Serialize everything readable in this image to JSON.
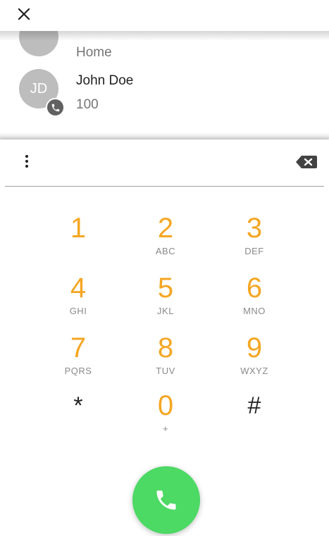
{
  "contacts": [
    {
      "name": "",
      "sub": "Home"
    },
    {
      "name": "John Doe",
      "initials": "JD",
      "sub": "100"
    }
  ],
  "dialer": {
    "number": "",
    "keys": [
      {
        "digit": "1",
        "letters": ""
      },
      {
        "digit": "2",
        "letters": "ABC"
      },
      {
        "digit": "3",
        "letters": "DEF"
      },
      {
        "digit": "4",
        "letters": "GHI"
      },
      {
        "digit": "5",
        "letters": "JKL"
      },
      {
        "digit": "6",
        "letters": "MNO"
      },
      {
        "digit": "7",
        "letters": "PQRS"
      },
      {
        "digit": "8",
        "letters": "TUV"
      },
      {
        "digit": "9",
        "letters": "WXYZ"
      },
      {
        "digit": "*",
        "letters": ""
      },
      {
        "digit": "0",
        "letters": "+"
      },
      {
        "digit": "#",
        "letters": ""
      }
    ]
  },
  "icons": {
    "close": "close-icon",
    "more": "more-vertical-icon",
    "backspace": "backspace-icon",
    "call": "phone-icon",
    "badge": "phone-icon"
  },
  "colors": {
    "digit": "#f5a623",
    "letters": "#8a8a8a",
    "call": "#4cd964",
    "avatar": "#bdbdbd"
  }
}
